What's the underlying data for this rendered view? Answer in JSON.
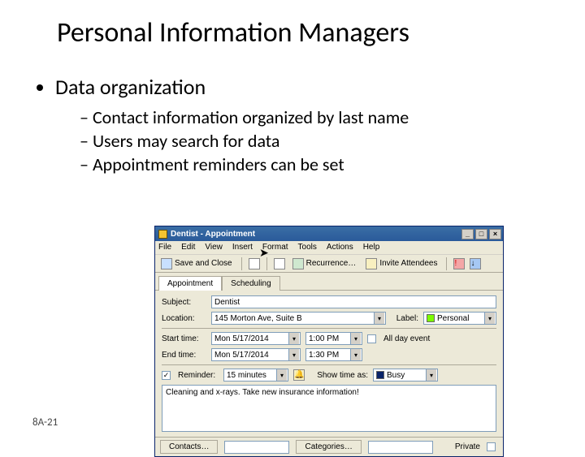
{
  "slide": {
    "title": "Personal Information Managers",
    "bullets": {
      "main": "Data organization",
      "sub": [
        "Contact information organized by last name",
        "Users may search for data",
        "Appointment reminders can be set"
      ]
    },
    "footer": "8A-21"
  },
  "window": {
    "title": "Dentist - Appointment",
    "title_controls": {
      "min": "_",
      "max": "□",
      "close": "×"
    },
    "menu": [
      "File",
      "Edit",
      "View",
      "Insert",
      "Format",
      "Tools",
      "Actions",
      "Help"
    ],
    "toolbar": {
      "save_close": "Save and Close",
      "recurrence": "Recurrence…",
      "invite": "Invite Attendees"
    },
    "tabs": {
      "appointment": "Appointment",
      "scheduling": "Scheduling"
    },
    "fields": {
      "subject_label": "Subject:",
      "subject_value": "Dentist",
      "location_label": "Location:",
      "location_value": "145 Morton Ave, Suite B",
      "label_label": "Label:",
      "label_value": "Personal",
      "label_color": "#7CFC00",
      "start_label": "Start time:",
      "start_date": "Mon 5/17/2014",
      "start_time": "1:00 PM",
      "allday_label": "All day event",
      "end_label": "End time:",
      "end_date": "Mon 5/17/2014",
      "end_time": "1:30 PM",
      "reminder_label": "Reminder:",
      "reminder_value": "15 minutes",
      "showtime_label": "Show time as:",
      "showtime_value": "Busy",
      "showtime_color": "#0a246a",
      "notes": "Cleaning and x-rays. Take new insurance information!"
    },
    "status": {
      "contacts": "Contacts…",
      "categories": "Categories…",
      "private": "Private"
    }
  }
}
